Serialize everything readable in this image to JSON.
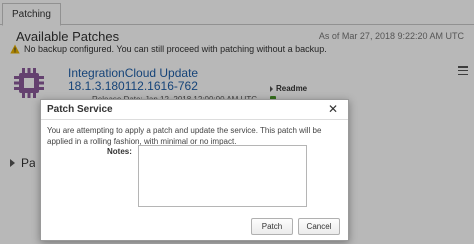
{
  "tabs": [
    {
      "label": "Patching"
    }
  ],
  "page": {
    "title": "Available Patches",
    "as_of": "As of Mar 27, 2018 9:22:20 AM UTC",
    "warning": "No backup configured. You can still proceed with patching without a backup."
  },
  "patch": {
    "name": "IntegrationCloud Update",
    "version": "18.1.3.180112.1616-762",
    "release_date": "Release Date:  Jan 12, 2018 12:00:00 AM UTC",
    "readme_label": "Readme",
    "icon": "chip-icon"
  },
  "section": {
    "label": "Patches"
  },
  "dialog": {
    "title": "Patch Service",
    "close_symbol": "✕",
    "message": "You are attempting to apply a patch and update the service. This patch will be applied in a rolling fashion, with minimal or no impact.",
    "notes_label": "Notes:",
    "notes_value": "",
    "patch_label": "Patch",
    "cancel_label": "Cancel"
  },
  "colors": {
    "link": "#1f5fa8",
    "warning": "#e8b200",
    "chip": "#8b5a9a"
  }
}
